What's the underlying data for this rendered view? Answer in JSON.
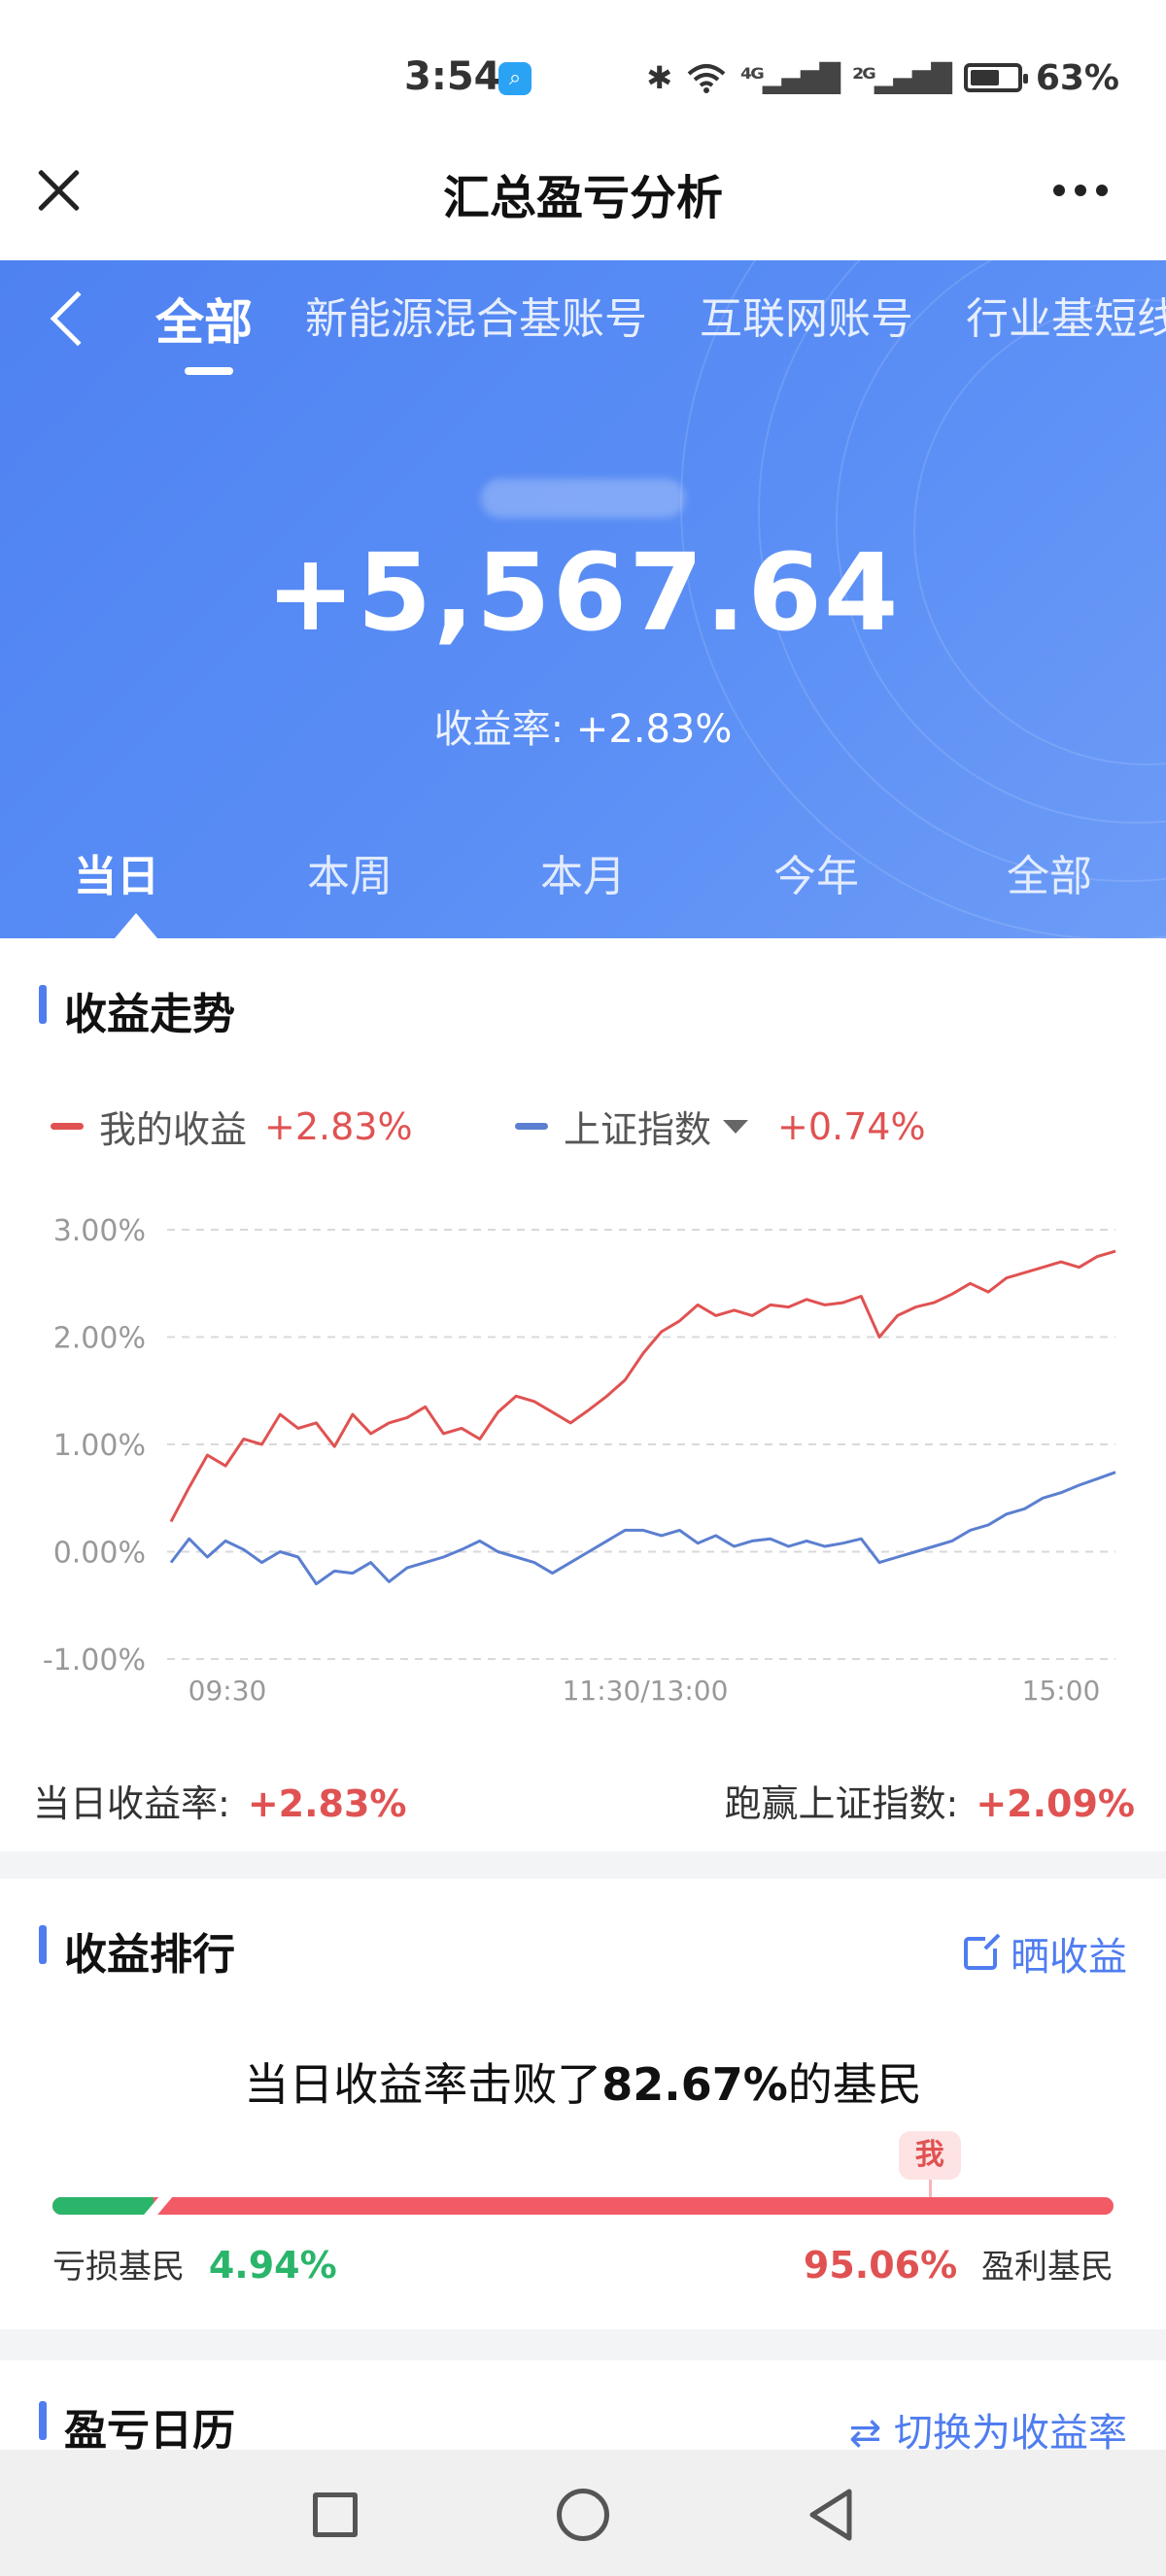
{
  "status": {
    "time": "3:54",
    "app_icon": "search-app-icon",
    "bluetooth": "✱",
    "net1": "⁴ᴳ",
    "net2": "²ᴳ",
    "battery": "63%",
    "battery_level": 0.63
  },
  "nav": {
    "title": "汇总盈亏分析"
  },
  "accounts": {
    "tabs": [
      "全部",
      "新能源混合基账号",
      "互联网账号",
      "行业基短线"
    ],
    "active_index": 0
  },
  "summary": {
    "amount": "+5,567.64",
    "rate_label": "收益率:",
    "rate_value": "+2.83%"
  },
  "periods": {
    "tabs": [
      "当日",
      "本周",
      "本月",
      "今年",
      "全部"
    ],
    "active_index": 0
  },
  "trend": {
    "title": "收益走势",
    "legend_mine_label": "我的收益",
    "legend_mine_value": "+2.83%",
    "legend_index_label": "上证指数",
    "legend_index_value": "+0.74%",
    "daily_rate_label": "当日收益率:",
    "daily_rate_value": "+2.83%",
    "beat_label": "跑赢上证指数:",
    "beat_value": "+2.09%"
  },
  "chart_data": {
    "type": "line",
    "y_ticks": [
      "3.00%",
      "2.00%",
      "1.00%",
      "0.00%",
      "-1.00%"
    ],
    "ylim": [
      -1.0,
      3.0
    ],
    "x_ticks": [
      "09:30",
      "11:30/13:00",
      "15:00"
    ],
    "grid": true,
    "series": [
      {
        "name": "我的收益",
        "color": "#e05252",
        "values": [
          0.28,
          0.6,
          0.9,
          0.8,
          1.05,
          1.0,
          1.28,
          1.15,
          1.2,
          0.98,
          1.28,
          1.1,
          1.2,
          1.25,
          1.35,
          1.1,
          1.15,
          1.05,
          1.3,
          1.45,
          1.4,
          1.3,
          1.2,
          1.32,
          1.45,
          1.6,
          1.85,
          2.05,
          2.15,
          2.3,
          2.2,
          2.25,
          2.2,
          2.3,
          2.28,
          2.35,
          2.3,
          2.32,
          2.38,
          2.0,
          2.2,
          2.28,
          2.32,
          2.4,
          2.5,
          2.42,
          2.55,
          2.6,
          2.65,
          2.7,
          2.65,
          2.75,
          2.8
        ]
      },
      {
        "name": "上证指数",
        "color": "#5b7fd0",
        "values": [
          -0.1,
          0.12,
          -0.05,
          0.1,
          0.02,
          -0.1,
          0.0,
          -0.05,
          -0.3,
          -0.18,
          -0.2,
          -0.1,
          -0.28,
          -0.15,
          -0.1,
          -0.05,
          0.02,
          0.1,
          0.0,
          -0.05,
          -0.1,
          -0.2,
          -0.1,
          0.0,
          0.1,
          0.2,
          0.2,
          0.15,
          0.2,
          0.08,
          0.15,
          0.05,
          0.1,
          0.12,
          0.05,
          0.1,
          0.05,
          0.08,
          0.12,
          -0.1,
          -0.05,
          0.0,
          0.05,
          0.1,
          0.2,
          0.25,
          0.35,
          0.4,
          0.5,
          0.55,
          0.62,
          0.68,
          0.74
        ]
      }
    ]
  },
  "ranking": {
    "title": "收益排行",
    "share_label": "晒收益",
    "beat_prefix": "当日收益率击败了",
    "beat_percent": "82.67%",
    "beat_suffix": "的基民",
    "me_label": "我",
    "me_position": 0.8267,
    "loss_label": "亏损基民",
    "loss_value": "4.94%",
    "loss_fraction": 0.0494,
    "profit_value": "95.06%",
    "profit_label": "盈利基民"
  },
  "calendar": {
    "title": "盈亏日历",
    "switch_label": "切换为收益率"
  },
  "colors": {
    "brand_blue": "#4f82f1",
    "red": "#e05252",
    "green": "#2ab56a"
  }
}
